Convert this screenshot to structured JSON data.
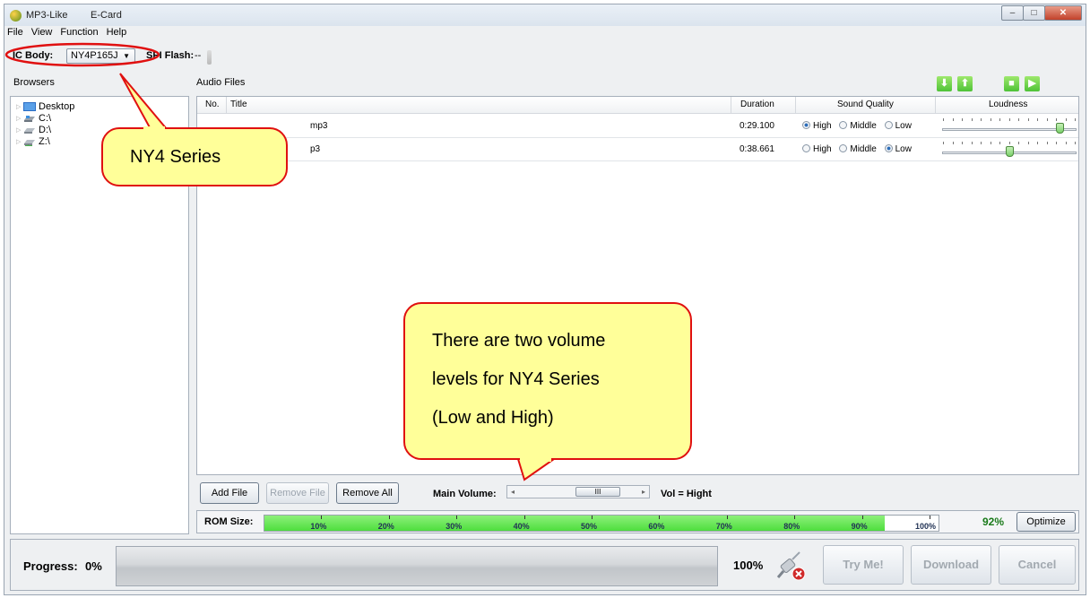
{
  "window": {
    "title_app": "MP3-Like",
    "title_mode": "E-Card",
    "btn_min": "‒",
    "btn_max": "□",
    "btn_close": "✕"
  },
  "menu": [
    "File",
    "View",
    "Function",
    "Help"
  ],
  "toolbar": {
    "ic_body_label": "IC Body:",
    "ic_body_value": "NY4P165J",
    "spi_flash_label": "SPI Flash:",
    "spi_flash_value": "--"
  },
  "browsers": {
    "header": "Browsers",
    "items": [
      {
        "label": "Desktop",
        "icon": "desktop-icon"
      },
      {
        "label": "C:\\",
        "icon": "drive-icon"
      },
      {
        "label": "D:\\",
        "icon": "drive-icon"
      },
      {
        "label": "Z:\\",
        "icon": "network-drive-icon"
      }
    ]
  },
  "audio": {
    "header": "Audio Files",
    "columns": {
      "no": "No.",
      "title": "Title",
      "duration": "Duration",
      "quality": "Sound Quality",
      "loudness": "Loudness"
    },
    "quality_options": [
      "High",
      "Middle",
      "Low"
    ],
    "rows": [
      {
        "title": "mp3",
        "duration": "0:29.100",
        "quality": "High",
        "loudness": 0.9
      },
      {
        "title": "p3",
        "duration": "0:38.661",
        "quality": "Low",
        "loudness": 0.5
      }
    ]
  },
  "controls": {
    "add_file": "Add File",
    "remove_file": "Remove File",
    "remove_all": "Remove All",
    "main_volume_label": "Main Volume:",
    "volume_thumb": "III",
    "vol_text": "Vol = Hight",
    "scroll_left": "◂",
    "scroll_right": "▸"
  },
  "rom": {
    "label": "ROM Size:",
    "ticks": [
      "10%",
      "20%",
      "30%",
      "40%",
      "50%",
      "60%",
      "70%",
      "80%",
      "90%",
      "100%"
    ],
    "fill": 0.92,
    "percent": "92%",
    "optimize": "Optimize"
  },
  "progress": {
    "label": "Progress:",
    "value": "0%",
    "right_value": "100%",
    "try_me": "Try Me!",
    "download": "Download",
    "cancel": "Cancel"
  },
  "callouts": {
    "series": "NY4 Series",
    "volume": [
      "There are two volume",
      "levels for NY4 Series",
      "(Low and High)"
    ]
  },
  "colors": {
    "accent_green": "#4ede3e",
    "callout_fill": "#ffff99",
    "callout_border": "#e01010"
  }
}
